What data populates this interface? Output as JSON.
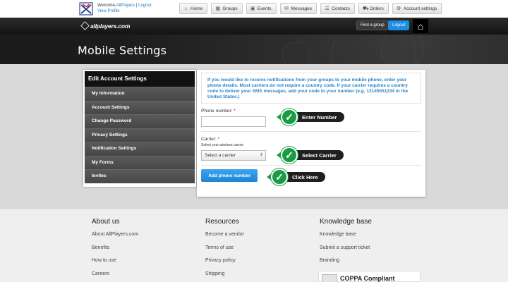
{
  "topbar": {
    "welcome_prefix": "Welcome,",
    "username": "AllPlayers",
    "separator": " | ",
    "logout_link": "Logout",
    "view_profile": "View Profile",
    "nav": [
      {
        "label": "Home",
        "icon": "home-icon",
        "glyph": "⌂"
      },
      {
        "label": "Groups",
        "icon": "groups-icon",
        "glyph": "▦"
      },
      {
        "label": "Events",
        "icon": "calendar-icon",
        "glyph": "▣"
      },
      {
        "label": "Messages",
        "icon": "envelope-icon",
        "glyph": "✉"
      },
      {
        "label": "Contacts",
        "icon": "contacts-icon",
        "glyph": "☰"
      },
      {
        "label": "Orders",
        "icon": "cart-icon",
        "glyph": "⛟"
      },
      {
        "label": "Account settings",
        "icon": "gear-icon",
        "glyph": "⚙"
      }
    ]
  },
  "header": {
    "brand": "allplayers.com",
    "find_group": "Find a group",
    "logout": "Logout",
    "home_icon": "home-icon"
  },
  "page": {
    "title": "Mobile Settings"
  },
  "sidebar": {
    "heading": "Edit Account Settings",
    "items": [
      {
        "label": "My Information"
      },
      {
        "label": "Account Settings"
      },
      {
        "label": "Change Password"
      },
      {
        "label": "Privacy Settings"
      },
      {
        "label": "Notification Settings"
      },
      {
        "label": "My Forms"
      },
      {
        "label": "Invites"
      }
    ]
  },
  "form": {
    "info": "If you would like to receive notifications from your groups to your mobile phone, enter your phone details. Most carriers do not require a country code. If your carrier requires a country code to deliver your SMS messages, add your code to your number (e.g. 12145551234 in the United States.)",
    "phone_label": "Phone number:",
    "phone_value": "",
    "carrier_label": "Carrier:",
    "carrier_hint": "Select your wireless carrier.",
    "carrier_selected": "Select a carrier",
    "required_mark": "*",
    "submit": "Add phone number"
  },
  "callouts": {
    "enter_number": "Enter Number",
    "select_carrier": "Select Carrier",
    "click_here": "Click Here",
    "accent": "#1c9b46"
  },
  "footer": {
    "columns": [
      {
        "title": "About us",
        "links": [
          "About AllPlayers.com",
          "Benefits",
          "How to use",
          "Careers"
        ]
      },
      {
        "title": "Resources",
        "links": [
          "Become a vendor",
          "Terms of use",
          "Privacy policy",
          "Shipping"
        ]
      },
      {
        "title": "Knowledge base",
        "links": [
          "Knowledge base",
          "Submit a support ticket",
          "Branding"
        ]
      }
    ],
    "coppa": "COPPA Compliant"
  }
}
